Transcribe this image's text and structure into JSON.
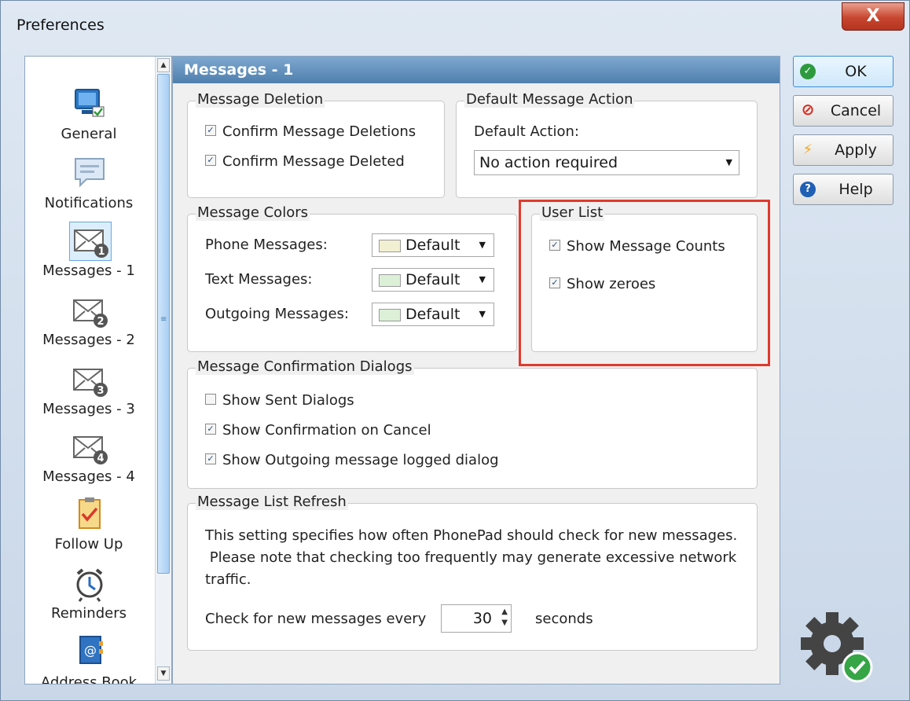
{
  "window": {
    "title": "Preferences",
    "close_glyph": "X"
  },
  "sidebar": {
    "items": [
      {
        "label": "General",
        "icon": "monitor-check-icon"
      },
      {
        "label": "Notifications",
        "icon": "speech-bubble-icon"
      },
      {
        "label": "Messages - 1",
        "icon": "envelope-1-icon",
        "badge": "1",
        "selected": true
      },
      {
        "label": "Messages - 2",
        "icon": "envelope-2-icon",
        "badge": "2"
      },
      {
        "label": "Messages - 3",
        "icon": "envelope-3-icon",
        "badge": "3"
      },
      {
        "label": "Messages - 4",
        "icon": "envelope-4-icon",
        "badge": "4"
      },
      {
        "label": "Follow Up",
        "icon": "clipboard-check-icon"
      },
      {
        "label": "Reminders",
        "icon": "alarm-clock-icon"
      },
      {
        "label": "Address Book",
        "icon": "address-book-icon"
      }
    ]
  },
  "panel": {
    "title": "Messages - 1",
    "message_deletion": {
      "legend": "Message Deletion",
      "options": [
        {
          "label": "Confirm Message Deletions",
          "checked": true
        },
        {
          "label": "Confirm Message Deleted",
          "checked": true
        }
      ]
    },
    "default_action": {
      "legend": "Default Message Action",
      "field_label": "Default Action:",
      "value": "No action required"
    },
    "message_colors": {
      "legend": "Message Colors",
      "rows": [
        {
          "label": "Phone Messages:",
          "value": "Default",
          "swatch": "#f2f0d2"
        },
        {
          "label": "Text Messages:",
          "value": "Default",
          "swatch": "#dcf0d8"
        },
        {
          "label": "Outgoing Messages:",
          "value": "Default",
          "swatch": "#dcf0d8"
        }
      ]
    },
    "user_list": {
      "legend": "User List",
      "options": [
        {
          "label": "Show Message Counts",
          "checked": true
        },
        {
          "label": "Show zeroes",
          "checked": true
        }
      ]
    },
    "confirmation_dialogs": {
      "legend": "Message Confirmation Dialogs",
      "options": [
        {
          "label": "Show Sent Dialogs",
          "checked": false
        },
        {
          "label": "Show Confirmation on Cancel",
          "checked": true
        },
        {
          "label": "Show Outgoing message logged dialog",
          "checked": true
        }
      ]
    },
    "list_refresh": {
      "legend": "Message List Refresh",
      "description_lines": [
        "This setting specifies how often PhonePad should check for new messages.",
        " Please note that checking too frequently may generate excessive network",
        "traffic."
      ],
      "prefix": "Check for new messages every",
      "value": "30",
      "suffix": "seconds"
    }
  },
  "buttons": {
    "ok": "OK",
    "cancel": "Cancel",
    "apply": "Apply",
    "help": "Help"
  },
  "colors": {
    "highlight": "#e03a2e",
    "header_start": "#7ea8cf",
    "header_end": "#4f7fae"
  }
}
